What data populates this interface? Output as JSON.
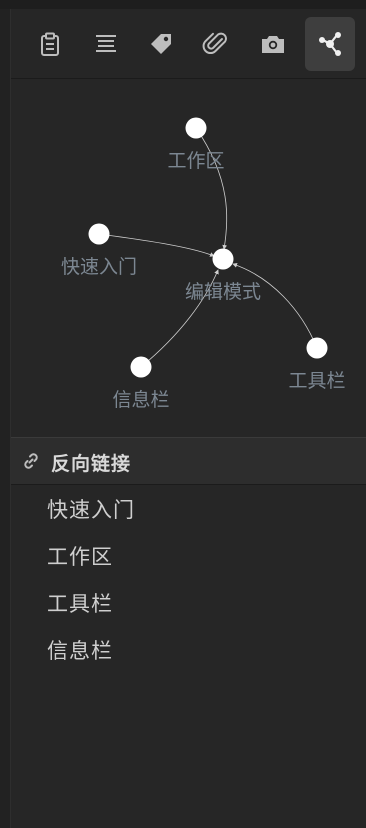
{
  "toolbar": {
    "buttons": [
      {
        "icon": "clipboard-icon",
        "active": false
      },
      {
        "icon": "outline-icon",
        "active": false
      },
      {
        "icon": "tag-icon",
        "active": false
      },
      {
        "icon": "attachment-icon",
        "active": false
      },
      {
        "icon": "camera-icon",
        "active": false
      },
      {
        "icon": "graph-icon",
        "active": true
      }
    ]
  },
  "graph": {
    "nodes": [
      {
        "label": "工作区"
      },
      {
        "label": "快速入门"
      },
      {
        "label": "编辑模式"
      },
      {
        "label": "信息栏"
      },
      {
        "label": "工具栏"
      }
    ]
  },
  "backlinks": {
    "title": "反向链接",
    "items": [
      "快速入门",
      "工作区",
      "工具栏",
      "信息栏"
    ]
  }
}
